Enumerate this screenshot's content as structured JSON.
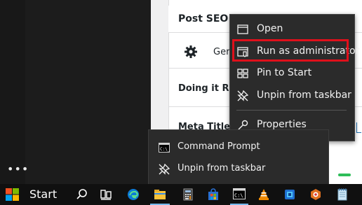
{
  "left_panel": {
    "more_label": "•••"
  },
  "webpage": {
    "card_title": "Post SEO S",
    "tab_label": "Ger",
    "section_title": "Doing it Rig",
    "meta_title_label": "Meta Title"
  },
  "context_menu": {
    "items": [
      {
        "label": "Open",
        "icon": "window-icon"
      },
      {
        "label": "Run as administrator",
        "icon": "shield-icon"
      },
      {
        "label": "Pin to Start",
        "icon": "pin-start-icon"
      },
      {
        "label": "Unpin from taskbar",
        "icon": "unpin-icon"
      },
      {
        "label": "Properties",
        "icon": "wrench-icon"
      }
    ],
    "highlight_color": "#e0101b"
  },
  "jump_list": {
    "items": [
      {
        "label": "Command Prompt",
        "icon": "cmd-icon"
      },
      {
        "label": "Unpin from taskbar",
        "icon": "unpin-icon"
      }
    ]
  },
  "taskbar": {
    "start_label": "Start",
    "icons": [
      "search-icon",
      "task-view-icon",
      "edge-icon",
      "file-explorer-icon",
      "calculator-icon",
      "store-icon",
      "cmd-icon",
      "vlc-icon",
      "app-blue-icon",
      "app-orange-icon",
      "notepad-icon"
    ],
    "accent": "#76b9ed"
  }
}
